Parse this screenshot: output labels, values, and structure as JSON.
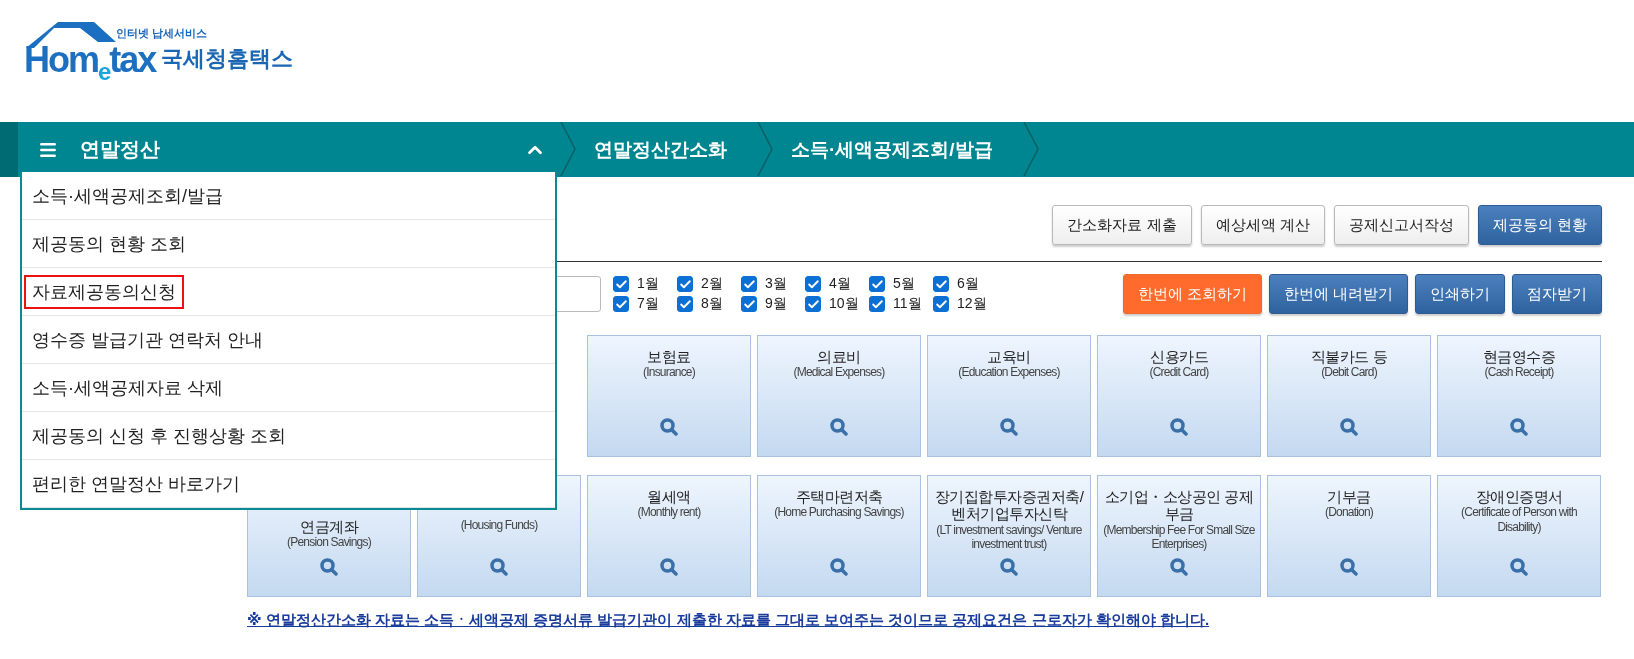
{
  "logo": {
    "tagline": "인터넷 납세서비스",
    "wordmark": [
      "Hom",
      "e",
      "tax"
    ],
    "name": "국세청홈택스"
  },
  "nav": {
    "menu_title": "연말정산",
    "expanded": true,
    "breadcrumbs": [
      "연말정산간소화",
      "소득·세액공제조회/발급"
    ]
  },
  "menu_items": [
    {
      "label": "소득·세액공제조회/발급",
      "selected": false
    },
    {
      "label": "제공동의 현황 조회",
      "selected": false
    },
    {
      "label": "자료제공동의신청",
      "selected": true
    },
    {
      "label": "영수증 발급기관 연락처 안내",
      "selected": false
    },
    {
      "label": "소득·세액공제자료 삭제",
      "selected": false
    },
    {
      "label": "제공동의 신청 후 진행상황 조회",
      "selected": false
    },
    {
      "label": "편리한 연말정산 바로가기",
      "selected": false
    }
  ],
  "action_buttons": [
    {
      "label": "간소화자료 제출",
      "kind": "plain"
    },
    {
      "label": "예상세액 계산",
      "kind": "plain"
    },
    {
      "label": "공제신고서작성",
      "kind": "plain"
    },
    {
      "label": "제공동의 현황",
      "kind": "primary"
    }
  ],
  "months": [
    {
      "label": "1월",
      "checked": true
    },
    {
      "label": "2월",
      "checked": true
    },
    {
      "label": "3월",
      "checked": true
    },
    {
      "label": "4월",
      "checked": true
    },
    {
      "label": "5월",
      "checked": true
    },
    {
      "label": "6월",
      "checked": true
    },
    {
      "label": "7월",
      "checked": true
    },
    {
      "label": "8월",
      "checked": true
    },
    {
      "label": "9월",
      "checked": true
    },
    {
      "label": "10월",
      "checked": true
    },
    {
      "label": "11월",
      "checked": true
    },
    {
      "label": "12월",
      "checked": true
    }
  ],
  "query_buttons": [
    {
      "label": "한번에 조회하기",
      "kind": "accent"
    },
    {
      "label": "한번에 내려받기",
      "kind": "primary"
    },
    {
      "label": "인쇄하기",
      "kind": "primary"
    },
    {
      "label": "점자받기",
      "kind": "primary"
    }
  ],
  "card_rows": [
    [
      {
        "title": "보험료",
        "subtitle": "(Insurance)"
      },
      {
        "title": "의료비",
        "subtitle": "(Medical Expenses)"
      },
      {
        "title": "교육비",
        "subtitle": "(Education Expenses)"
      },
      {
        "title": "신용카드",
        "subtitle": "(Credit Card)"
      },
      {
        "title": "직불카드 등",
        "subtitle": "(Debit Card)"
      },
      {
        "title": "현금영수증",
        "subtitle": "(Cash Receipt)"
      }
    ],
    [
      {
        "title": "연금계좌",
        "subtitle": "(Pension Savings)"
      },
      {
        "subtitle": "(Housing Funds)"
      },
      {
        "title": "월세액",
        "subtitle": "(Monthly rent)"
      },
      {
        "title": "주택마련저축",
        "subtitle": "(Home Purchasing Savings)"
      },
      {
        "title": "장기집합투자증권저축/벤처기업투자신탁",
        "subtitle": "(LT investment savings/ Venture investment trust)"
      },
      {
        "title": "소기업・소상공인 공제부금",
        "subtitle": "(Membership Fee For Small Size Enterprises)"
      },
      {
        "title": "기부금",
        "subtitle": "(Donation)"
      },
      {
        "title": "장애인증명서",
        "subtitle": "(Certificate of Person with Disability)"
      }
    ]
  ],
  "notice": "※ 연말정산간소화 자료는 소득ㆍ세액공제 증명서류 발급기관이 제출한 자료를 그대로 보여주는 것이므로 공제요건은 근로자가 확인해야 합니다."
}
